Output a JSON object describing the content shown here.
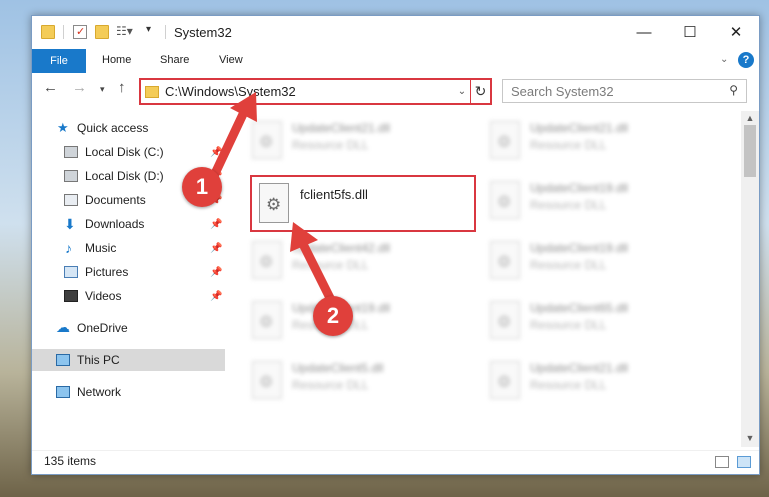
{
  "window": {
    "title": "System32"
  },
  "ribbon": {
    "file": "File",
    "tabs": [
      "Home",
      "Share",
      "View"
    ],
    "help": "?"
  },
  "navigation": {
    "path": "C:\\Windows\\System32",
    "search_placeholder": "Search System32"
  },
  "sidebar": {
    "items": [
      {
        "label": "Quick access"
      },
      {
        "label": "Local Disk (C:)"
      },
      {
        "label": "Local Disk (D:)"
      },
      {
        "label": "Documents"
      },
      {
        "label": "Downloads"
      },
      {
        "label": "Music"
      },
      {
        "label": "Pictures"
      },
      {
        "label": "Videos"
      },
      {
        "label": "OneDrive"
      },
      {
        "label": "This PC"
      },
      {
        "label": "Network"
      }
    ]
  },
  "files": {
    "highlighted": {
      "name": "fclient5fs.dll"
    },
    "items": [
      {
        "name": "UpdateClient21.dll",
        "type": "Resource DLL"
      },
      {
        "name": "UpdateClient21.dll",
        "type": "Resource DLL"
      },
      {
        "name": "UpdateClient19.dll",
        "type": "Resource DLL"
      },
      {
        "name": "UpdateClient42.dll",
        "type": "Resource DLL"
      },
      {
        "name": "UpdateClient19.dll",
        "type": "Resource DLL"
      },
      {
        "name": "UpdateClient19.dll",
        "type": "Resource DLL"
      },
      {
        "name": "UpdateClient65.dll",
        "type": "Resource DLL"
      },
      {
        "name": "UpdateClient5.dll",
        "type": "Resource DLL"
      },
      {
        "name": "UpdateClient21.dll",
        "type": "Resource DLL"
      }
    ]
  },
  "status": {
    "count": "135 items"
  },
  "callouts": {
    "one": "1",
    "two": "2"
  },
  "colors": {
    "accent": "#1979ca",
    "highlight": "#d93740",
    "callout": "#e0403b"
  }
}
